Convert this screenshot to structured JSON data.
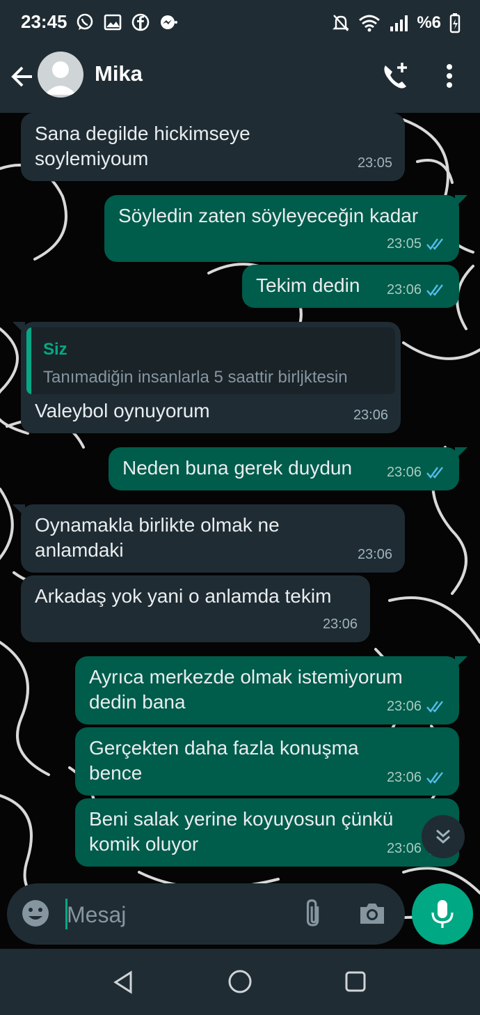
{
  "status": {
    "time": "23:45",
    "battery": "%6",
    "left_icons": [
      "whatsapp-icon",
      "image-icon",
      "facebook-icon",
      "messenger-icon"
    ],
    "right_icons": [
      "bell-off-icon",
      "wifi-icon",
      "signal-icon",
      "battery-icon"
    ]
  },
  "header": {
    "contact_name": "Mika",
    "icons": [
      "back-arrow-icon",
      "avatar-icon",
      "add-call-icon",
      "more-vert-icon"
    ]
  },
  "messages": [
    {
      "dir": "in",
      "text": "Sana degilde hickimseye\nsoylemiyoum",
      "time": "23:05"
    },
    {
      "dir": "out",
      "text": "Söyledin zaten söyleyeceğin kadar",
      "time": "23:05",
      "read": true
    },
    {
      "dir": "out",
      "text": "Tekim dedin",
      "time": "23:06",
      "read": true
    },
    {
      "dir": "in",
      "text": "Valeybol oynuyorum",
      "time": "23:06",
      "quote": {
        "author": "Siz",
        "text": "Tanımadiğin insanlarla 5 saattir birljktesin"
      }
    },
    {
      "dir": "out",
      "text": "Neden buna gerek duydun",
      "time": "23:06",
      "read": true
    },
    {
      "dir": "in",
      "text": "Oynamakla birlikte olmak ne\nanlamdaki",
      "time": "23:06"
    },
    {
      "dir": "in",
      "text": "Arkadaş yok yani o anlamda tekim",
      "time": "23:06"
    },
    {
      "dir": "out",
      "text": "Ayrıca merkezde olmak istemiyorum\ndedin bana",
      "time": "23:06",
      "read": true
    },
    {
      "dir": "out",
      "text": "Gerçekten daha fazla konuşma\nbence",
      "time": "23:06",
      "read": true
    },
    {
      "dir": "out",
      "text": "Beni salak yerine koyuyosun çünkü\nkomik oluyor",
      "time": "23:06",
      "read": true
    }
  ],
  "input": {
    "placeholder": "Mesaj",
    "icons": [
      "emoji-icon",
      "attach-icon",
      "camera-icon",
      "mic-icon"
    ]
  },
  "colors": {
    "bar_bg": "#1f2c34",
    "incoming_bubble": "#1f2c34",
    "outgoing_bubble": "#005c4b",
    "accent": "#00a884",
    "read_ticks": "#53bdeb"
  }
}
